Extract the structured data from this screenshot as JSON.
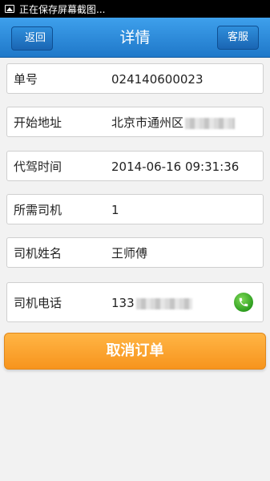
{
  "status_bar": {
    "text": "正在保存屏幕截图...",
    "icon": "image-icon"
  },
  "header": {
    "title": "详情",
    "back_label": "返回",
    "service_label": "客服"
  },
  "details": {
    "order_no": {
      "label": "单号",
      "value": "024140600023"
    },
    "start_address": {
      "label": "开始地址",
      "value": "北京市通州区"
    },
    "drive_time": {
      "label": "代驾时间",
      "value": "2014-06-16 09:31:36"
    },
    "drivers_needed": {
      "label": "所需司机",
      "value": "1"
    },
    "driver_name": {
      "label": "司机姓名",
      "value": "王师傅"
    },
    "driver_phone": {
      "label": "司机电话",
      "value": "133",
      "icon": "phone-call-icon"
    }
  },
  "actions": {
    "cancel_label": "取消订单"
  },
  "colors": {
    "header_blue": "#1f78c9",
    "cancel_orange": "#f7941d",
    "phone_green": "#2e9e1f"
  }
}
